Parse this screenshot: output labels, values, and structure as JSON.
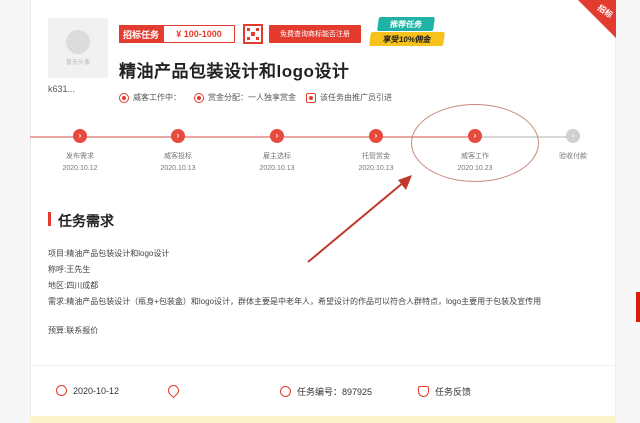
{
  "avatar": {
    "placeholder_text": "暂无头像"
  },
  "user": {
    "name": "k631..."
  },
  "tags": {
    "task_type": "招标任务",
    "price": "¥ 100-1000",
    "promo": "免费查询商标能否注册"
  },
  "badge": {
    "line1": "推荐任务",
    "line2": "享受10%佣金"
  },
  "corner": {
    "label": "招标"
  },
  "task": {
    "title": "精油产品包装设计和logo设计"
  },
  "meta": {
    "status": "威客工作中：",
    "reward": "赏金分配：一人独享赏金",
    "referral": "该任务由推广员引进"
  },
  "steps": [
    {
      "name": "发布需求",
      "date": "2020.10.12",
      "done": true
    },
    {
      "name": "威客投标",
      "date": "2020.10.13",
      "done": true
    },
    {
      "name": "雇主选标",
      "date": "2020.10.13",
      "done": true
    },
    {
      "name": "托管赏金",
      "date": "2020.10.13",
      "done": true
    },
    {
      "name": "威客工作",
      "date": "2020.10.23",
      "done": true
    },
    {
      "name": "验收付款",
      "date": "",
      "done": false
    }
  ],
  "section": {
    "title": "任务需求"
  },
  "requirements": {
    "project": "项目:精油产品包装设计和logo设计",
    "contact": "称呼:王先生",
    "region": "地区:四川成都",
    "need": "需求:精油产品包装设计（瓶身+包装盒）和logo设计，群体主要是中老年人，希望设计的作品可以符合人群特点，logo主要用于包装及宣传用",
    "budget": "预算:联系报价"
  },
  "footer": {
    "date": "2020-10-12",
    "task_id_label": "任务编号：897925",
    "feedback": "任务反馈"
  },
  "colors": {
    "accent": "#e33b2e",
    "teal": "#1fb3a6",
    "yellow": "#f6c21b"
  }
}
